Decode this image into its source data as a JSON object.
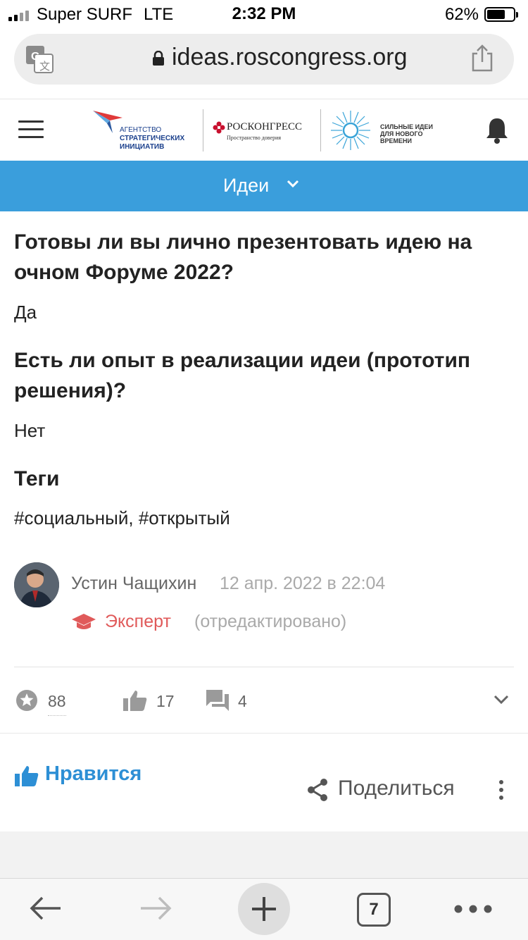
{
  "status_bar": {
    "carrier": "Super SURF",
    "network": "LTE",
    "time": "2:32 PM",
    "battery_percent": "62%",
    "battery_level": 0.62
  },
  "browser": {
    "url": "ideas.roscongress.org"
  },
  "header": {
    "logo_asi": [
      "АГЕНТСТВО",
      "СТРАТЕГИЧЕСКИХ",
      "ИНИЦИАТИВ"
    ],
    "logo_roscongress": "РОСКОНГРЕСС",
    "logo_roscongress_sub": "Пространство доверия",
    "logo_strong_ideas": [
      "СИЛЬНЫЕ ИДЕИ",
      "ДЛЯ НОВОГО",
      "ВРЕМЕНИ"
    ]
  },
  "nav": {
    "label": "Идеи"
  },
  "questions": [
    {
      "question": "Готовы ли вы лично презентовать идею на очном Форуме 2022?",
      "answer": "Да"
    },
    {
      "question": "Есть ли опыт в реализации идеи (прототип решения)?",
      "answer": "Нет"
    }
  ],
  "tags": {
    "heading": "Теги",
    "value": "#социальный, #открытый"
  },
  "author": {
    "name": "Устин Чащихин",
    "date": "12 апр. 2022 в 22:04",
    "role": "Эксперт",
    "edited": "(отредактировано)"
  },
  "stats": {
    "rating": "88",
    "likes": "17",
    "comments": "4"
  },
  "actions": {
    "like_label": "Нравится",
    "share_label": "Поделиться"
  },
  "toolbar": {
    "tab_count": "7"
  },
  "colors": {
    "nav_blue": "#3a9edc",
    "link_blue": "#2d8fd5",
    "expert_red": "#e05a5a"
  }
}
